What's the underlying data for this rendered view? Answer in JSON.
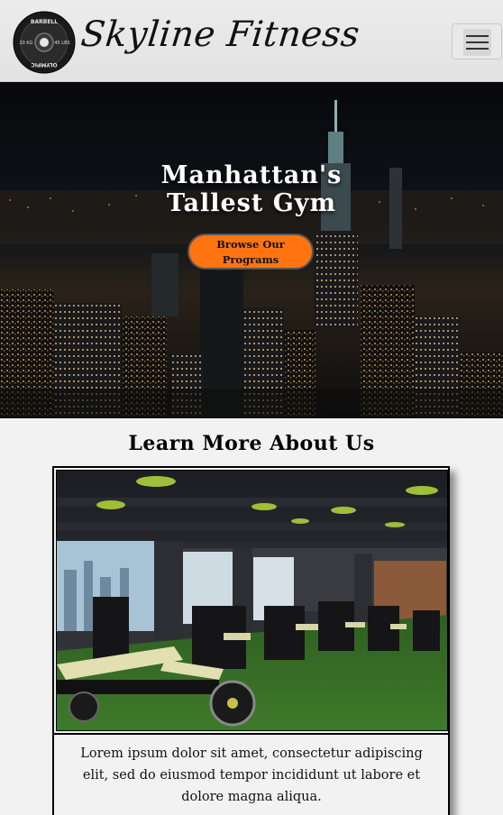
{
  "header": {
    "brand": "Skyline Fitness",
    "logo": {
      "icon": "weight-plate-icon",
      "plate_top_text": "BARBELL",
      "plate_bottom_text": "OLYMPIC",
      "plate_left_text": "20 KG",
      "plate_right_text": "45 LBS"
    },
    "menu_icon": "hamburger-menu-icon"
  },
  "hero": {
    "title_line1": "Manhattan's",
    "title_line2": "Tallest Gym",
    "cta_label": "Browse Our\nPrograms"
  },
  "about": {
    "title": "Learn More About Us",
    "image_subject": "gym-interior",
    "text": "Lorem ipsum dolor sit amet, consectetur adipiscing elit, sed do eiusmod tempor incididunt ut labore et dolore magna aliqua."
  },
  "colors": {
    "header_bg": "#e6e6e6",
    "cta_bg": "#ff7410",
    "page_bg": "#f2f2f2",
    "hero_bg": "#0a0b0e"
  }
}
